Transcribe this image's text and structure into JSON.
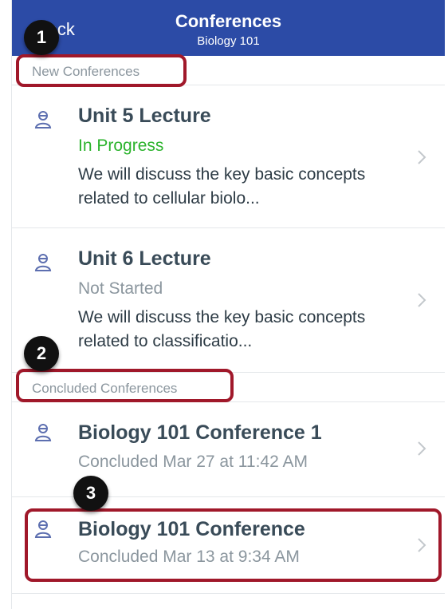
{
  "nav": {
    "back_label": "Back",
    "title": "Conferences",
    "subtitle": "Biology 101",
    "bg_color": "#2c4ba6"
  },
  "sections": [
    {
      "label": "New Conferences",
      "items": [
        {
          "icon": "conference-icon",
          "title": "Unit 5 Lecture",
          "status": "In Progress",
          "status_color": "#2bb32c",
          "description": "We will discuss the key basic concepts related to cellular biolo..."
        },
        {
          "icon": "conference-icon",
          "title": "Unit 6 Lecture",
          "status": "Not Started",
          "status_color": "#8b969e",
          "description": "We will discuss the key basic concepts related to classificatio..."
        }
      ]
    },
    {
      "label": "Concluded Conferences",
      "items": [
        {
          "icon": "conference-icon",
          "title": "Biology 101 Conference 1",
          "status": "Concluded Mar 27 at 11:42 AM"
        },
        {
          "icon": "conference-icon",
          "title": "Biology 101 Conference",
          "status": "Concluded Mar 13 at 9:34 AM"
        }
      ]
    }
  ],
  "annotations": {
    "marker_1": "1",
    "marker_2": "2",
    "marker_3": "3",
    "highlight_color": "#a0182a"
  }
}
